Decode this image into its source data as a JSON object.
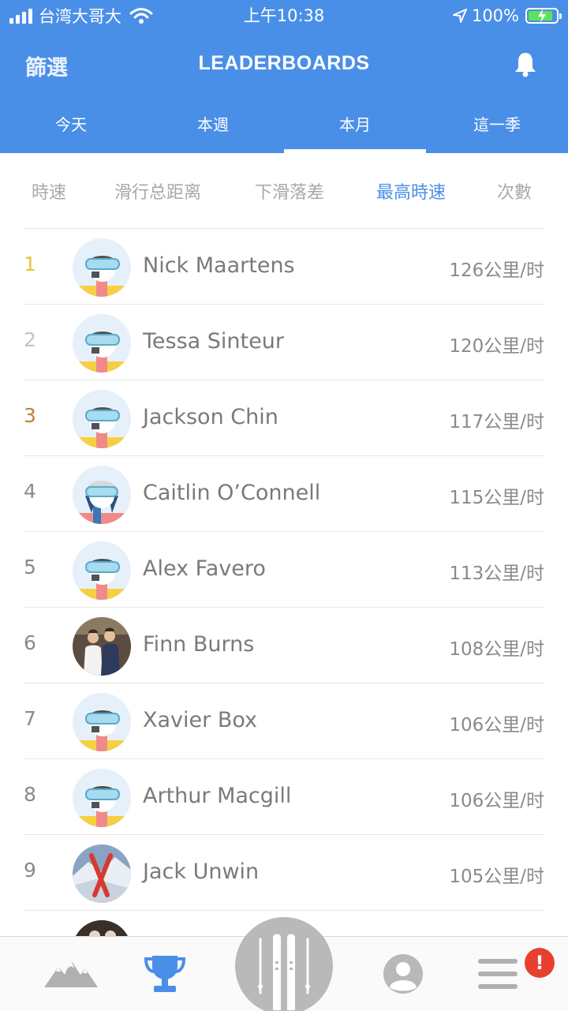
{
  "status_bar": {
    "carrier": "台湾大哥大",
    "time": "上午10:38",
    "battery": "100%"
  },
  "header": {
    "filter_label": "篩選",
    "title": "LEADERBOARDS"
  },
  "period_tabs": [
    {
      "label": "今天",
      "active": false
    },
    {
      "label": "本週",
      "active": false
    },
    {
      "label": "本月",
      "active": true
    },
    {
      "label": "這一季",
      "active": false
    }
  ],
  "metric_tabs": [
    {
      "label": "時速",
      "active": false
    },
    {
      "label": "滑行总距离",
      "active": false
    },
    {
      "label": "下滑落差",
      "active": false
    },
    {
      "label": "最高時速",
      "active": true
    },
    {
      "label": "次數",
      "active": false
    }
  ],
  "leaderboard": [
    {
      "rank": "1",
      "name": "Nick Maartens",
      "value": "126公里/时",
      "avatar": "skier-avatar"
    },
    {
      "rank": "2",
      "name": "Tessa Sinteur",
      "value": "120公里/时",
      "avatar": "skier-avatar"
    },
    {
      "rank": "3",
      "name": "Jackson Chin",
      "value": "117公里/时",
      "avatar": "skier-avatar"
    },
    {
      "rank": "4",
      "name": "Caitlin O’Connell",
      "value": "115公里/时",
      "avatar": "skier-avatar-female"
    },
    {
      "rank": "5",
      "name": "Alex Favero",
      "value": "113公里/时",
      "avatar": "skier-avatar"
    },
    {
      "rank": "6",
      "name": "Finn Burns",
      "value": "108公里/时",
      "avatar": "photo-avatar"
    },
    {
      "rank": "7",
      "name": "Xavier Box",
      "value": "106公里/时",
      "avatar": "skier-avatar"
    },
    {
      "rank": "8",
      "name": "Arthur Macgill",
      "value": "106公里/时",
      "avatar": "skier-avatar"
    },
    {
      "rank": "9",
      "name": "Jack Unwin",
      "value": "105公里/时",
      "avatar": "snow-photo-avatar"
    }
  ],
  "tabbar": {
    "badge": "!"
  },
  "colors": {
    "brand_blue": "#4a8fe7",
    "gold": "#e8c242",
    "silver": "#c4c4c4",
    "bronze": "#b78630",
    "alert_red": "#e8402f"
  },
  "icons": [
    "signal-icon",
    "wifi-icon",
    "location-arrow-icon",
    "battery-icon",
    "bell-icon",
    "mountains-icon",
    "trophy-icon",
    "skis-icon",
    "profile-icon",
    "menu-icon"
  ]
}
